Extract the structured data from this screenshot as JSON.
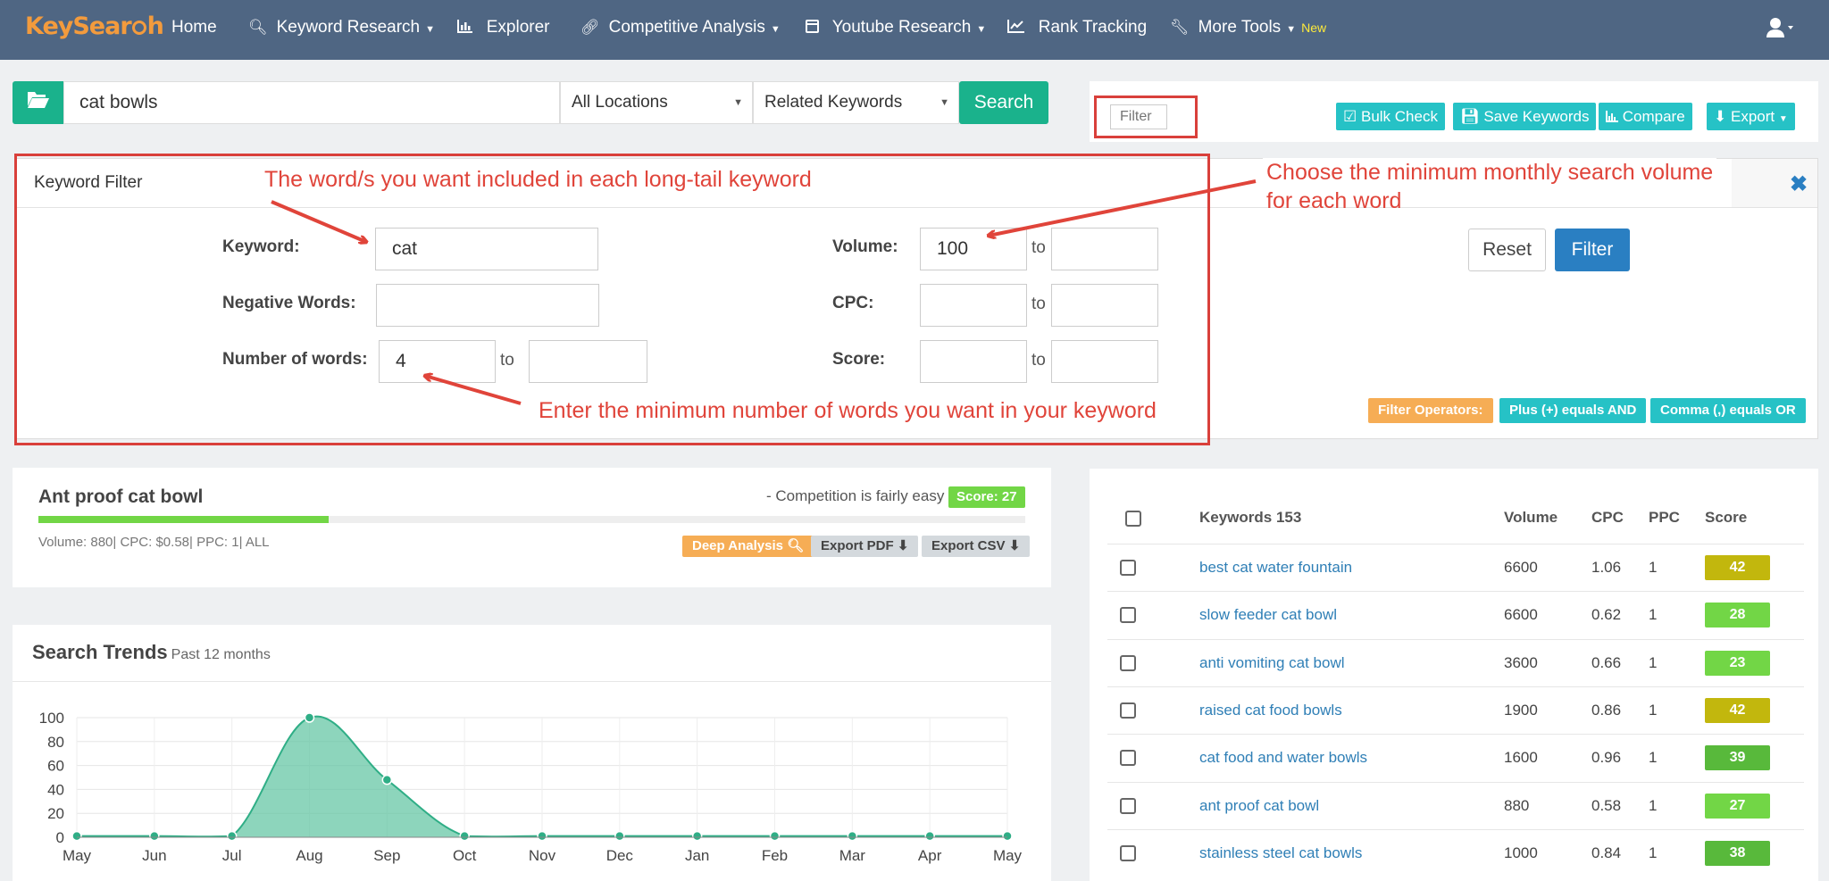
{
  "nav": {
    "logo_left": "KeySear",
    "logo_right": "h",
    "items": [
      {
        "label": "Home",
        "icon": ""
      },
      {
        "label": "Keyword Research",
        "icon": "search-icon",
        "caret": true
      },
      {
        "label": "Explorer",
        "icon": "bar-chart-icon"
      },
      {
        "label": "Competitive Analysis",
        "icon": "link-icon",
        "caret": true
      },
      {
        "label": "Youtube Research",
        "icon": "calendar-icon",
        "caret": true
      },
      {
        "label": "Rank Tracking",
        "icon": "line-chart-icon"
      },
      {
        "label": "More Tools",
        "icon": "wrench-icon",
        "caret": true,
        "badge": "New"
      }
    ]
  },
  "search": {
    "query": "cat bowls",
    "location": "All Locations",
    "mode": "Related Keywords",
    "button": "Search"
  },
  "toolbar": {
    "filter_placeholder": "Filter",
    "bulk_check": "Bulk Check",
    "save_keywords": "Save Keywords",
    "compare": "Compare",
    "export": "Export"
  },
  "filter_panel": {
    "title": "Keyword Filter",
    "keyword_label": "Keyword:",
    "keyword_value": "cat",
    "negative_label": "Negative Words:",
    "negative_value": "",
    "words_label": "Number of words:",
    "words_min": "4",
    "words_max": "",
    "volume_label": "Volume:",
    "volume_min": "100",
    "volume_max": "",
    "cpc_label": "CPC:",
    "score_label": "Score:",
    "to": "to",
    "reset": "Reset",
    "filter": "Filter",
    "operators_label": "Filter Operators:",
    "op_and": "Plus (+) equals AND",
    "op_or": "Comma (,) equals OR"
  },
  "annotations": {
    "top": "The word/s you want included in each long-tail keyword",
    "right_1": "Choose the minimum monthly search volume",
    "right_2": "for each word",
    "bottom": "Enter the minimum number of words you want in your keyword"
  },
  "summary": {
    "keyword": "Ant proof cat bowl",
    "competition": "- Competition is fairly easy",
    "score": "Score: 27",
    "score_value": 27,
    "meta": "Volume: 880| CPC: $0.58| PPC: 1| ALL",
    "deep_analysis": "Deep Analysis",
    "export_pdf": "Export PDF",
    "export_csv": "Export CSV"
  },
  "trends": {
    "title": "Search Trends",
    "subtitle": "Past 12 months"
  },
  "chart_data": {
    "type": "area",
    "categories": [
      "May",
      "Jun",
      "Jul",
      "Aug",
      "Sep",
      "Oct",
      "Nov",
      "Dec",
      "Jan",
      "Feb",
      "Mar",
      "Apr",
      "May"
    ],
    "values": [
      1,
      1,
      1,
      100,
      48,
      1,
      1,
      1,
      1,
      1,
      1,
      1,
      1
    ],
    "yticks": [
      "0",
      "20",
      "40",
      "60",
      "80",
      "100"
    ],
    "ylim": [
      0,
      100
    ],
    "grid": true,
    "color": "#5cc3a0"
  },
  "table": {
    "col_keywords": "Keywords 153",
    "col_volume": "Volume",
    "col_cpc": "CPC",
    "col_ppc": "PPC",
    "col_score": "Score",
    "rows": [
      {
        "keyword": "best cat water fountain",
        "volume": "6600",
        "cpc": "1.06",
        "ppc": "1",
        "score": "42",
        "color": "#c2b70d"
      },
      {
        "keyword": "slow feeder cat bowl",
        "volume": "6600",
        "cpc": "0.62",
        "ppc": "1",
        "score": "28",
        "color": "#72d646"
      },
      {
        "keyword": "anti vomiting cat bowl",
        "volume": "3600",
        "cpc": "0.66",
        "ppc": "1",
        "score": "23",
        "color": "#72d646"
      },
      {
        "keyword": "raised cat food bowls",
        "volume": "1900",
        "cpc": "0.86",
        "ppc": "1",
        "score": "42",
        "color": "#c2b70d"
      },
      {
        "keyword": "cat food and water bowls",
        "volume": "1600",
        "cpc": "0.96",
        "ppc": "1",
        "score": "39",
        "color": "#58b93b"
      },
      {
        "keyword": "ant proof cat bowl",
        "volume": "880",
        "cpc": "0.58",
        "ppc": "1",
        "score": "27",
        "color": "#72d646"
      },
      {
        "keyword": "stainless steel cat bowls",
        "volume": "1000",
        "cpc": "0.84",
        "ppc": "1",
        "score": "38",
        "color": "#58b93b"
      }
    ]
  }
}
